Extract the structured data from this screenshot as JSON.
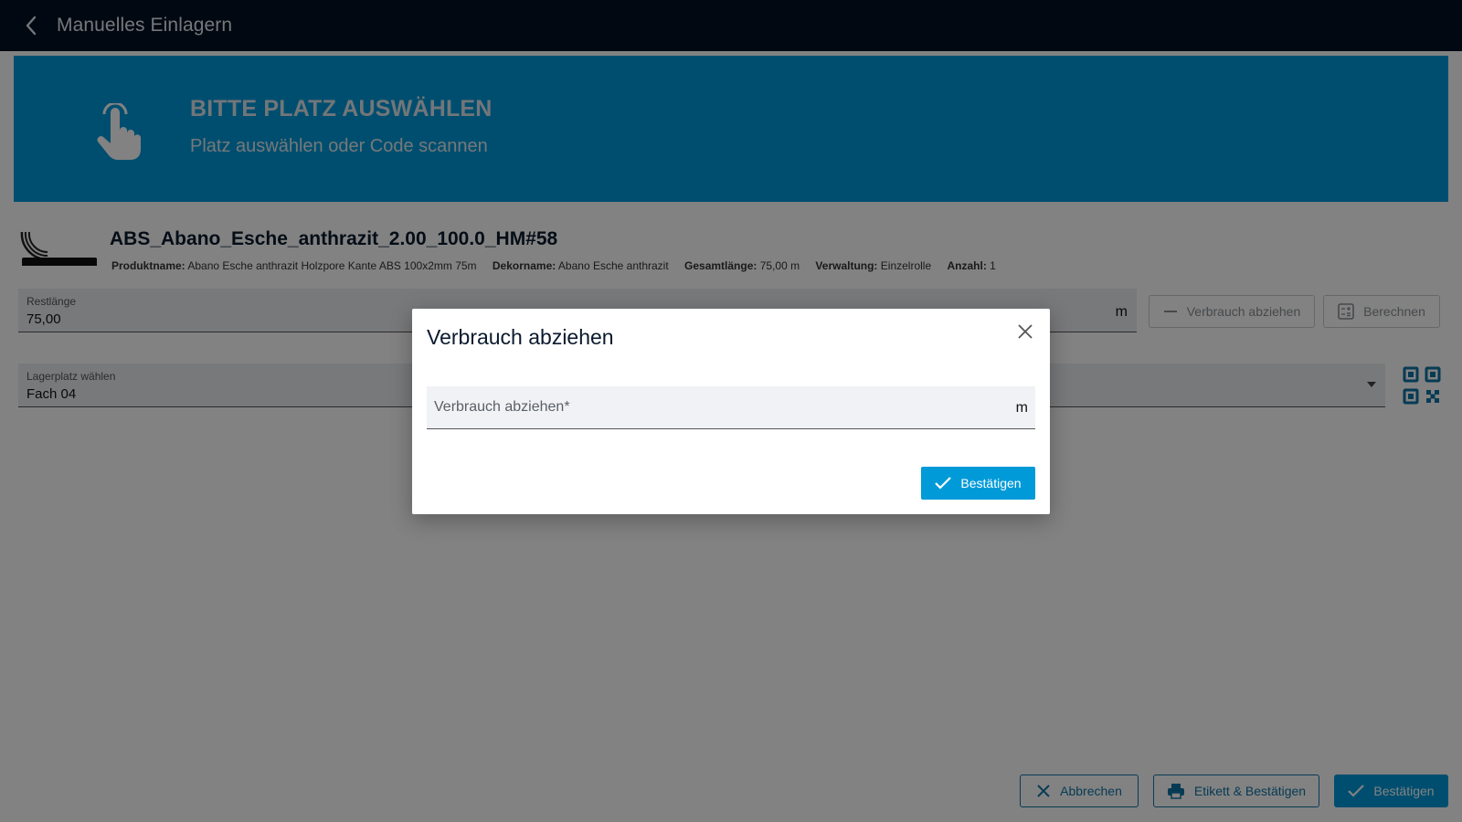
{
  "header": {
    "title": "Manuelles Einlagern",
    "back_icon": "chevron-left-icon"
  },
  "banner": {
    "title": "BITTE PLATZ AUSWÄHLEN",
    "subtitle": "Platz auswählen oder Code scannen",
    "icon": "hand-pointer-icon"
  },
  "product": {
    "icon": "edge-band-roll-icon",
    "title": "ABS_Abano_Esche_anthrazit_2.00_100.0_HM#58",
    "meta": [
      {
        "label": "Produktname:",
        "value": "Abano Esche anthrazit Holzpore Kante ABS 100x2mm 75m"
      },
      {
        "label": "Dekorname:",
        "value": "Abano Esche anthrazit"
      },
      {
        "label": "Gesamtlänge:",
        "value": "75,00 m"
      },
      {
        "label": "Verwaltung:",
        "value": "Einzelrolle"
      },
      {
        "label": "Anzahl:",
        "value": "1"
      }
    ]
  },
  "restlaenge": {
    "label": "Restlänge",
    "value": "75,00",
    "unit": "m"
  },
  "actions": {
    "verbrauch_label": "Verbrauch abziehen",
    "berechnen_label": "Berechnen"
  },
  "lagerplatz": {
    "label": "Lagerplatz wählen",
    "value": "Fach 04"
  },
  "bottom": {
    "cancel_label": "Abbrechen",
    "print_confirm_label": "Etikett & Bestätigen",
    "confirm_label": "Bestätigen"
  },
  "dialog": {
    "title": "Verbrauch abziehen",
    "input_placeholder": "Verbrauch abziehen*",
    "unit": "m",
    "confirm_label": "Bestätigen"
  },
  "colors": {
    "header_bg": "#021124",
    "accent": "#009ad9",
    "outline_accent": "#0e74a6"
  }
}
